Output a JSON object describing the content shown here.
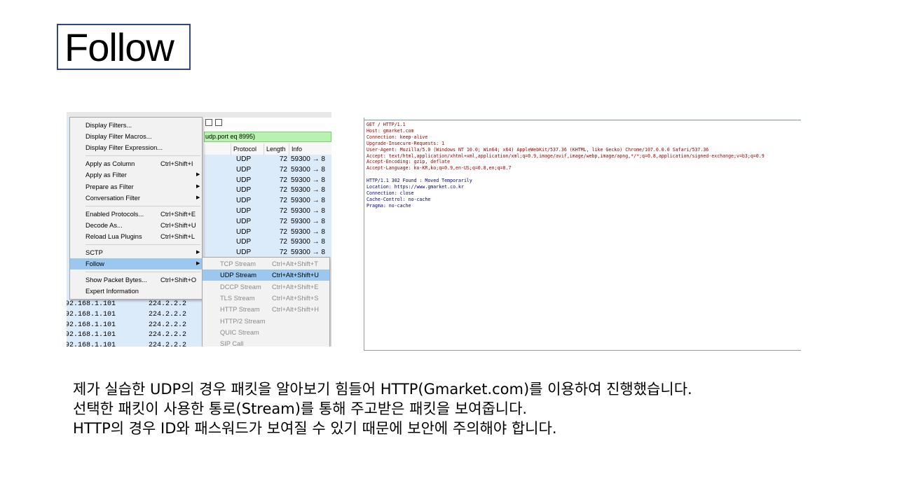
{
  "slide": {
    "title": "Follow",
    "description": [
      "제가 실습한 UDP의 경우 패킷을 알아보기 힘들어 HTTP(Gmarket.com)를 이용하여 진행했습니다.",
      "선택한 패킷이 사용한 통로(Stream)를 통해 주고받은 패킷을 보여줍니다.",
      "HTTP의 경우 ID와 패스워드가 보여질 수 있기 때문에 보안에 주의해야 합니다."
    ]
  },
  "wireshark": {
    "filter_text": "udp.port eq 8995)",
    "columns": {
      "protocol": "Protocol",
      "length": "Length",
      "info": "Info"
    },
    "rows": [
      {
        "protocol": "UDP",
        "length": "72",
        "info": "59300 → 8"
      },
      {
        "protocol": "UDP",
        "length": "72",
        "info": "59300 → 8"
      },
      {
        "protocol": "UDP",
        "length": "72",
        "info": "59300 → 8"
      },
      {
        "protocol": "UDP",
        "length": "72",
        "info": "59300 → 8"
      },
      {
        "protocol": "UDP",
        "length": "72",
        "info": "59300 → 8"
      },
      {
        "protocol": "UDP",
        "length": "72",
        "info": "59300 → 8"
      },
      {
        "protocol": "UDP",
        "length": "72",
        "info": "59300 → 8"
      },
      {
        "protocol": "UDP",
        "length": "72",
        "info": "59300 → 8"
      },
      {
        "protocol": "UDP",
        "length": "72",
        "info": "59300 → 8"
      },
      {
        "protocol": "UDP",
        "length": "72",
        "info": "59300 → 8"
      }
    ],
    "bottom_rows": [
      {
        "source": "92.168.1.101",
        "destination": "224.2.2.2"
      },
      {
        "source": "92.168.1.101",
        "destination": "224.2.2.2"
      },
      {
        "source": "92.168.1.101",
        "destination": "224.2.2.2"
      },
      {
        "source": "92.168.1.101",
        "destination": "224.2.2.2"
      },
      {
        "source": "92.168.1.101",
        "destination": "224.2.2.2"
      }
    ],
    "menu": [
      {
        "label": "Display Filters...",
        "shortcut": "",
        "arrow": ""
      },
      {
        "label": "Display Filter Macros...",
        "shortcut": "",
        "arrow": ""
      },
      {
        "label": "Display Filter Expression...",
        "shortcut": "",
        "arrow": ""
      },
      {
        "label": "Apply as Column",
        "shortcut": "Ctrl+Shift+I",
        "arrow": ""
      },
      {
        "label": "Apply as Filter",
        "shortcut": "",
        "arrow": "▶"
      },
      {
        "label": "Prepare as Filter",
        "shortcut": "",
        "arrow": "▶"
      },
      {
        "label": "Conversation Filter",
        "shortcut": "",
        "arrow": "▶"
      },
      {
        "label": "Enabled Protocols...",
        "shortcut": "Ctrl+Shift+E",
        "arrow": ""
      },
      {
        "label": "Decode As...",
        "shortcut": "Ctrl+Shift+U",
        "arrow": ""
      },
      {
        "label": "Reload Lua Plugins",
        "shortcut": "Ctrl+Shift+L",
        "arrow": ""
      },
      {
        "label": "SCTP",
        "shortcut": "",
        "arrow": "▶"
      },
      {
        "label": "Follow",
        "shortcut": "",
        "arrow": "▶"
      },
      {
        "label": "Show Packet Bytes...",
        "shortcut": "Ctrl+Shift+O",
        "arrow": ""
      },
      {
        "label": "Expert Information",
        "shortcut": "",
        "arrow": ""
      }
    ],
    "submenu": [
      {
        "label": "TCP Stream",
        "shortcut": "Ctrl+Alt+Shift+T"
      },
      {
        "label": "UDP Stream",
        "shortcut": "Ctrl+Alt+Shift+U"
      },
      {
        "label": "DCCP Stream",
        "shortcut": "Ctrl+Alt+Shift+E"
      },
      {
        "label": "TLS Stream",
        "shortcut": "Ctrl+Alt+Shift+S"
      },
      {
        "label": "HTTP Stream",
        "shortcut": "Ctrl+Alt+Shift+H"
      },
      {
        "label": "HTTP/2 Stream",
        "shortcut": ""
      },
      {
        "label": "QUIC Stream",
        "shortcut": ""
      },
      {
        "label": "SIP Call",
        "shortcut": ""
      }
    ]
  },
  "stream": {
    "request_lines": [
      "GET / HTTP/1.1",
      "Host: gmarket.com",
      "Connection: keep-alive",
      "Upgrade-Insecure-Requests: 1",
      "User-Agent: Mozilla/5.0 (Windows NT 10.0; Win64; x64) AppleWebKit/537.36 (KHTML, like Gecko) Chrome/107.0.0.0 Safari/537.36",
      "Accept: text/html,application/xhtml+xml,application/xml;q=0.9,image/avif,image/webp,image/apng,*/*;q=0.8,application/signed-exchange;v=b3;q=0.9",
      "Accept-Encoding: gzip, deflate",
      "Accept-Language: ko-KR,ko;q=0.9,en-US;q=0.8,en;q=0.7"
    ],
    "response_lines": [
      "HTTP/1.1 302 Found : Moved Temporarily",
      "Location: https://www.gmarket.co.kr",
      "Connection: close",
      "Cache-Control: no-cache",
      "Pragma: no-cache"
    ],
    "colors": {
      "request": "#a00000",
      "response": "#00008b"
    }
  }
}
